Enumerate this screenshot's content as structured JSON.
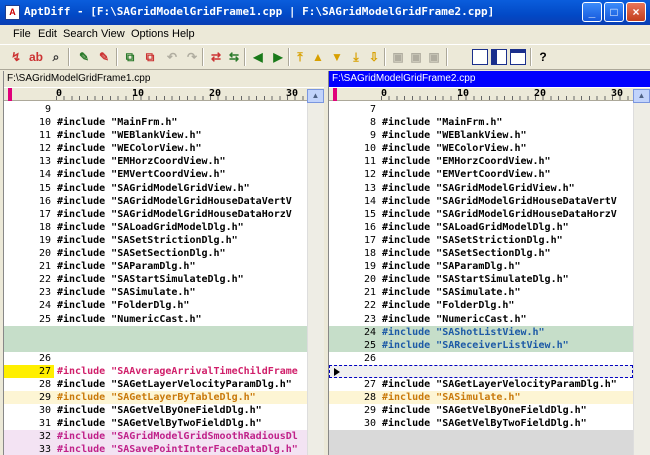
{
  "window": {
    "title": "AptDiff - [F:\\SAGridModelGridFrame1.cpp | F:\\SAGridModelGridFrame2.cpp]",
    "minimize": "_",
    "maximize": "□",
    "close": "×"
  },
  "menu": [
    "File",
    "Edit",
    "Search",
    "View",
    "Options",
    "Help"
  ],
  "toolbar_icons": [
    "compare-icon",
    "recompare-icon",
    "find-icon",
    "edit-left-icon",
    "edit-right-icon",
    "copy-left-icon",
    "copy-right-icon",
    "undo-icon",
    "redo-icon",
    "merge-left-icon",
    "merge-right-icon",
    "prev-icon",
    "next-icon",
    "first-diff-icon",
    "prev-diff-icon",
    "next-diff-icon",
    "last-diff-icon",
    "save-left-icon",
    "save-right-icon",
    "save-all-icon",
    "layout-horizontal-icon",
    "layout-vertical-icon",
    "layout-both-icon",
    "help-icon"
  ],
  "ruler": {
    "m0": "0",
    "m10": "10",
    "m20": "20",
    "m30": "30"
  },
  "left": {
    "file": "F:\\SAGridModelGridFrame1.cpp",
    "lines": [
      {
        "n": "9",
        "t": "",
        "kind": "normal"
      },
      {
        "n": "10",
        "t": "#include \"MainFrm.h\"",
        "kind": "normal"
      },
      {
        "n": "11",
        "t": "#include \"WEBlankView.h\"",
        "kind": "normal"
      },
      {
        "n": "12",
        "t": "#include \"WEColorView.h\"",
        "kind": "normal"
      },
      {
        "n": "13",
        "t": "#include \"EMHorzCoordView.h\"",
        "kind": "normal"
      },
      {
        "n": "14",
        "t": "#include \"EMVertCoordView.h\"",
        "kind": "normal"
      },
      {
        "n": "15",
        "t": "#include \"SAGridModelGridView.h\"",
        "kind": "normal"
      },
      {
        "n": "16",
        "t": "#include \"SAGridModelGridHouseDataVertV",
        "kind": "normal"
      },
      {
        "n": "17",
        "t": "#include \"SAGridModelGridHouseDataHorzV",
        "kind": "normal"
      },
      {
        "n": "18",
        "t": "#include \"SALoadGridModelDlg.h\"",
        "kind": "normal"
      },
      {
        "n": "19",
        "t": "#include \"SASetStrictionDlg.h\"",
        "kind": "normal"
      },
      {
        "n": "20",
        "t": "#include \"SASetSectionDlg.h\"",
        "kind": "normal"
      },
      {
        "n": "21",
        "t": "#include \"SAParamDlg.h\"",
        "kind": "normal"
      },
      {
        "n": "22",
        "t": "#include \"SAStartSimulateDlg.h\"",
        "kind": "normal"
      },
      {
        "n": "23",
        "t": "#include \"SASimulate.h\"",
        "kind": "normal"
      },
      {
        "n": "24",
        "t": "#include \"FolderDlg.h\"",
        "kind": "normal"
      },
      {
        "n": "25",
        "t": "#include \"NumericCast.h\"",
        "kind": "normal"
      },
      {
        "n": "",
        "t": "",
        "kind": "blank-added"
      },
      {
        "n": "",
        "t": "",
        "kind": "blank-added"
      },
      {
        "n": "26",
        "t": "",
        "kind": "normal"
      },
      {
        "n": "27",
        "t": "#include \"SAAverageArrivalTimeChildFrame",
        "kind": "changed-cur"
      },
      {
        "n": "28",
        "t": "#include \"SAGetLayerVelocityParamDlg.h\"",
        "kind": "normal"
      },
      {
        "n": "29",
        "t": "#include \"SAGetLayerByTableDlg.h\"",
        "kind": "yellow"
      },
      {
        "n": "30",
        "t": "#include \"SAGetVelByOneFieldDlg.h\"",
        "kind": "normal"
      },
      {
        "n": "31",
        "t": "#include \"SAGetVelByTwoFieldDlg.h\"",
        "kind": "normal"
      },
      {
        "n": "32",
        "t": "#include \"SAGridModelGridSmoothRadiousDl",
        "kind": "pink"
      },
      {
        "n": "33",
        "t": "#include \"SASavePointInterFaceDataDlg.h\"",
        "kind": "pink"
      }
    ]
  },
  "right": {
    "file": "F:\\SAGridModelGridFrame2.cpp",
    "lines": [
      {
        "n": "7",
        "t": "",
        "kind": "normal"
      },
      {
        "n": "8",
        "t": "#include \"MainFrm.h\"",
        "kind": "normal"
      },
      {
        "n": "9",
        "t": "#include \"WEBlankView.h\"",
        "kind": "normal"
      },
      {
        "n": "10",
        "t": "#include \"WEColorView.h\"",
        "kind": "normal"
      },
      {
        "n": "11",
        "t": "#include \"EMHorzCoordView.h\"",
        "kind": "normal"
      },
      {
        "n": "12",
        "t": "#include \"EMVertCoordView.h\"",
        "kind": "normal"
      },
      {
        "n": "13",
        "t": "#include \"SAGridModelGridView.h\"",
        "kind": "normal"
      },
      {
        "n": "14",
        "t": "#include \"SAGridModelGridHouseDataVertV",
        "kind": "normal"
      },
      {
        "n": "15",
        "t": "#include \"SAGridModelGridHouseDataHorzV",
        "kind": "normal"
      },
      {
        "n": "16",
        "t": "#include \"SALoadGridModelDlg.h\"",
        "kind": "normal"
      },
      {
        "n": "17",
        "t": "#include \"SASetStrictionDlg.h\"",
        "kind": "normal"
      },
      {
        "n": "18",
        "t": "#include \"SASetSectionDlg.h\"",
        "kind": "normal"
      },
      {
        "n": "19",
        "t": "#include \"SAParamDlg.h\"",
        "kind": "normal"
      },
      {
        "n": "20",
        "t": "#include \"SAStartSimulateDlg.h\"",
        "kind": "normal"
      },
      {
        "n": "21",
        "t": "#include \"SASimulate.h\"",
        "kind": "normal"
      },
      {
        "n": "22",
        "t": "#include \"FolderDlg.h\"",
        "kind": "normal"
      },
      {
        "n": "23",
        "t": "#include \"NumericCast.h\"",
        "kind": "normal"
      },
      {
        "n": "24",
        "t": "#include \"SAShotListView.h\"",
        "kind": "added"
      },
      {
        "n": "25",
        "t": "#include \"SAReceiverListView.h\"",
        "kind": "added"
      },
      {
        "n": "26",
        "t": "",
        "kind": "normal"
      },
      {
        "n": "",
        "t": "",
        "kind": "cur"
      },
      {
        "n": "27",
        "t": "#include \"SAGetLayerVelocityParamDlg.h\"",
        "kind": "normal"
      },
      {
        "n": "28",
        "t": "#include \"SASimulate.h\"",
        "kind": "yellow"
      },
      {
        "n": "29",
        "t": "#include \"SAGetVelByOneFieldDlg.h\"",
        "kind": "normal"
      },
      {
        "n": "30",
        "t": "#include \"SAGetVelByTwoFieldDlg.h\"",
        "kind": "normal"
      },
      {
        "n": "",
        "t": "",
        "kind": "grey"
      },
      {
        "n": "",
        "t": "",
        "kind": "grey"
      }
    ]
  }
}
